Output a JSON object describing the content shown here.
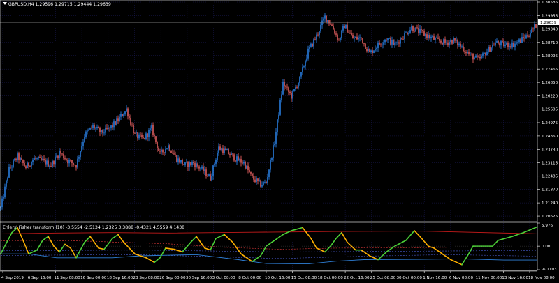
{
  "window": {
    "symbol_header": "GBPUSD,H4  1.29596 1.29715 1.29444 1.29639",
    "current_price_label": "1.29639"
  },
  "colors": {
    "background": "#000000",
    "grid": "#1c1c5a",
    "frame": "#ffffff",
    "bull_candle": "#2e8fff",
    "bear_candle": "#ff6b6b",
    "fisher_up": "#4cd137",
    "fisher_down": "#ffb000",
    "upper_band": "#c21a1a",
    "mid_band": "#e83b3b",
    "level_blue": "#2f7fd6",
    "level_dash": "#4a5ccf"
  },
  "price_axis": {
    "ticks": [
      "1.30585",
      "1.29955",
      "1.29340",
      "1.28710",
      "1.28095",
      "1.27465",
      "1.26850",
      "1.26220",
      "1.25605",
      "1.24975",
      "1.24360",
      "1.23730",
      "1.23115",
      "1.22485",
      "1.21870",
      "1.21240",
      "1.20625"
    ]
  },
  "indicator": {
    "title": "Ehlers' Fisher transform (10) -3.5554 -2.5134 1.2325 3.3888 -0.4321 4.5559 4.1438",
    "axis_ticks": [
      "5.976",
      "0.00",
      "-6.1103"
    ]
  },
  "time_axis": {
    "labels": [
      "4 Sep 2019",
      "6 Sep 16:00",
      "11 Sep 08:00",
      "16 Sep 00:00",
      "18 Sep 16:00",
      "23 Sep 08:00",
      "26 Sep 00:00",
      "30 Sep 16:00",
      "3 Oct 08:00",
      "8 Oct 00:00",
      "10 Oct 16:00",
      "15 Oct 08:00",
      "18 Oct 00:00",
      "22 Oct 16:00",
      "25 Oct 08:00",
      "30 Oct 00:00",
      "1 Nov 16:00",
      "6 Nov 08:00",
      "11 Nov 00:00",
      "13 Nov 16:00",
      "18 Nov 08:00"
    ]
  },
  "chart_data": [
    {
      "type": "candlestick",
      "title": "GBPUSD,H4",
      "ylim": [
        1.204,
        1.3065
      ],
      "price_path": [
        [
          0,
          1.21
        ],
        [
          6,
          1.228
        ],
        [
          12,
          1.234
        ],
        [
          18,
          1.229
        ],
        [
          24,
          1.233
        ],
        [
          30,
          1.232
        ],
        [
          36,
          1.23
        ],
        [
          42,
          1.236
        ],
        [
          48,
          1.232
        ],
        [
          54,
          1.23
        ],
        [
          60,
          1.244
        ],
        [
          66,
          1.248
        ],
        [
          72,
          1.245
        ],
        [
          78,
          1.247
        ],
        [
          84,
          1.251
        ],
        [
          90,
          1.256
        ],
        [
          96,
          1.244
        ],
        [
          102,
          1.242
        ],
        [
          108,
          1.247
        ],
        [
          114,
          1.235
        ],
        [
          120,
          1.239
        ],
        [
          126,
          1.233
        ],
        [
          132,
          1.23
        ],
        [
          138,
          1.231
        ],
        [
          144,
          1.228
        ],
        [
          150,
          1.224
        ],
        [
          156,
          1.238
        ],
        [
          162,
          1.236
        ],
        [
          168,
          1.233
        ],
        [
          174,
          1.231
        ],
        [
          180,
          1.224
        ],
        [
          186,
          1.221
        ],
        [
          190,
          1.222
        ],
        [
          196,
          1.241
        ],
        [
          202,
          1.268
        ],
        [
          208,
          1.262
        ],
        [
          214,
          1.27
        ],
        [
          220,
          1.283
        ],
        [
          226,
          1.29
        ],
        [
          232,
          1.299
        ],
        [
          236,
          1.296
        ],
        [
          242,
          1.288
        ],
        [
          246,
          1.295
        ],
        [
          252,
          1.289
        ],
        [
          258,
          1.289
        ],
        [
          264,
          1.282
        ],
        [
          270,
          1.286
        ],
        [
          276,
          1.289
        ],
        [
          282,
          1.286
        ],
        [
          288,
          1.29
        ],
        [
          294,
          1.294
        ],
        [
          300,
          1.292
        ],
        [
          306,
          1.29
        ],
        [
          312,
          1.288
        ],
        [
          318,
          1.287
        ],
        [
          324,
          1.288
        ],
        [
          330,
          1.285
        ],
        [
          336,
          1.281
        ],
        [
          342,
          1.279
        ],
        [
          348,
          1.283
        ],
        [
          354,
          1.287
        ],
        [
          360,
          1.286
        ],
        [
          366,
          1.286
        ],
        [
          372,
          1.288
        ],
        [
          378,
          1.291
        ],
        [
          384,
          1.296
        ]
      ]
    },
    {
      "type": "line",
      "title": "Ehlers' Fisher transform (10)",
      "ylim": [
        -6.1103,
        5.976
      ],
      "series": [
        {
          "points": [
            [
              0,
              -2
            ],
            [
              8,
              3.5
            ],
            [
              12,
              4.8
            ],
            [
              16,
              1.5
            ],
            [
              20,
              -2
            ],
            [
              26,
              -1
            ],
            [
              30,
              1.5
            ],
            [
              34,
              2.5
            ],
            [
              38,
              0
            ],
            [
              42,
              -1.5
            ],
            [
              46,
              0.5
            ],
            [
              50,
              -0.5
            ],
            [
              54,
              -3
            ],
            [
              60,
              1
            ],
            [
              64,
              2.5
            ],
            [
              70,
              -0.5
            ],
            [
              74,
              -0.8
            ],
            [
              80,
              2
            ],
            [
              84,
              3
            ],
            [
              88,
              1
            ],
            [
              96,
              -2
            ],
            [
              104,
              -3
            ],
            [
              110,
              -4.2
            ],
            [
              114,
              -3
            ],
            [
              118,
              -0.5
            ],
            [
              124,
              -0.8
            ],
            [
              130,
              -1.5
            ],
            [
              136,
              1
            ],
            [
              140,
              2.5
            ],
            [
              146,
              -0.5
            ],
            [
              150,
              -1
            ],
            [
              154,
              2
            ],
            [
              160,
              3
            ],
            [
              166,
              1
            ],
            [
              172,
              -2
            ],
            [
              180,
              -4
            ],
            [
              186,
              -2.5
            ],
            [
              190,
              0
            ],
            [
              196,
              1.5
            ],
            [
              202,
              3
            ],
            [
              208,
              4
            ],
            [
              216,
              4.8
            ],
            [
              222,
              2
            ],
            [
              226,
              -0.5
            ],
            [
              232,
              -1.5
            ],
            [
              236,
              0
            ],
            [
              240,
              2
            ],
            [
              244,
              3.5
            ],
            [
              248,
              1
            ],
            [
              254,
              -1
            ],
            [
              258,
              -1
            ],
            [
              264,
              -2.5
            ],
            [
              270,
              -3.5
            ],
            [
              276,
              -1.5
            ],
            [
              282,
              0
            ],
            [
              290,
              1.5
            ],
            [
              296,
              4
            ],
            [
              300,
              2.5
            ],
            [
              306,
              0
            ],
            [
              310,
              -0.5
            ],
            [
              316,
              -2
            ],
            [
              322,
              -3.5
            ],
            [
              330,
              -4.8
            ],
            [
              334,
              -2.5
            ],
            [
              338,
              0
            ],
            [
              344,
              0
            ],
            [
              352,
              0
            ],
            [
              356,
              1.5
            ],
            [
              366,
              2.5
            ],
            [
              374,
              3.5
            ],
            [
              384,
              5
            ]
          ]
        },
        {
          "points": [
            [
              0,
              3.2
            ],
            [
              40,
              3.4
            ],
            [
              80,
              3.5
            ],
            [
              120,
              3.4
            ],
            [
              180,
              3.6
            ],
            [
              240,
              3.8
            ],
            [
              300,
              3.9
            ],
            [
              384,
              3.2
            ]
          ]
        },
        {
          "points": [
            [
              0,
              1.4
            ],
            [
              30,
              1.5
            ],
            [
              60,
              1.3
            ],
            [
              120,
              0.6
            ],
            [
              160,
              -0.3
            ],
            [
              200,
              -0.8
            ],
            [
              240,
              -0.5
            ],
            [
              300,
              -0.4
            ],
            [
              340,
              -0.2
            ],
            [
              384,
              -0.3
            ]
          ]
        },
        {
          "points": [
            [
              0,
              -2.4
            ],
            [
              100,
              -2.2
            ],
            [
              200,
              -3.2
            ],
            [
              260,
              -2.6
            ],
            [
              320,
              -2.2
            ],
            [
              384,
              -2.6
            ]
          ]
        },
        {
          "points": [
            [
              0,
              -1.2
            ],
            [
              100,
              -1.0
            ],
            [
              200,
              -1.5
            ],
            [
              300,
              -1.3
            ],
            [
              384,
              -1.1
            ]
          ]
        },
        {
          "points": [
            [
              0,
              -2
            ],
            [
              20,
              -2
            ],
            [
              40,
              -3
            ],
            [
              60,
              -3
            ],
            [
              80,
              -3
            ],
            [
              100,
              -2.5
            ],
            [
              140,
              -2.2
            ],
            [
              170,
              -3.5
            ],
            [
              190,
              -4.5
            ],
            [
              220,
              -4.6
            ],
            [
              240,
              -3.9
            ],
            [
              260,
              -3.5
            ],
            [
              300,
              -3.4
            ],
            [
              330,
              -3.3
            ],
            [
              360,
              -3.6
            ],
            [
              384,
              -3.6
            ]
          ]
        }
      ]
    }
  ]
}
